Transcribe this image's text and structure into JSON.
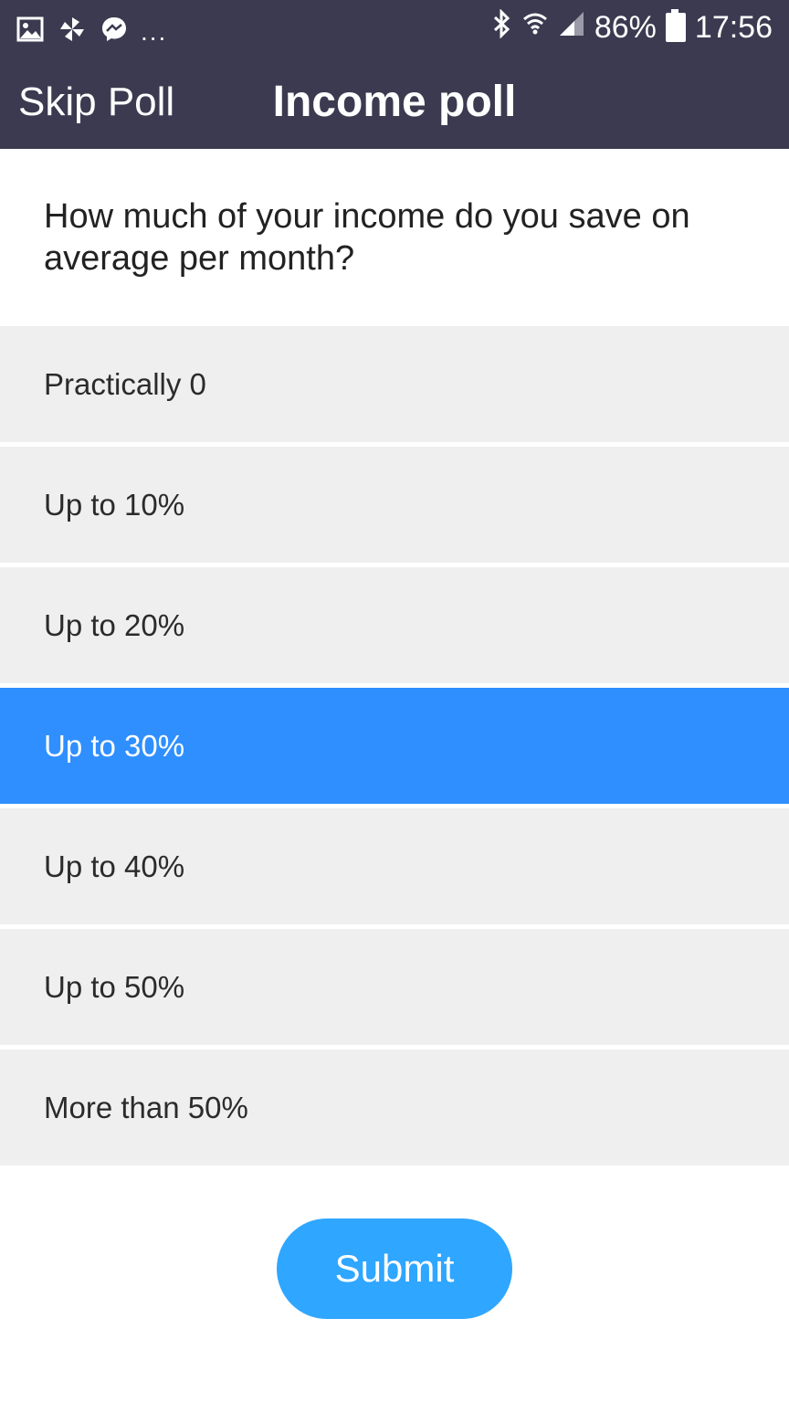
{
  "status_bar": {
    "left_icons": [
      "gallery-icon",
      "pinwheel-icon",
      "messenger-icon"
    ],
    "more": "...",
    "right_icons": [
      "bluetooth-icon",
      "wifi-icon",
      "signal-icon",
      "battery-icon"
    ],
    "battery": "86%",
    "time": "17:56"
  },
  "header": {
    "skip_label": "Skip Poll",
    "title": "Income poll",
    "background": "#3b3a50"
  },
  "poll": {
    "question": "How much of your income do you save on average per month?",
    "options": [
      {
        "label": "Practically 0",
        "selected": false
      },
      {
        "label": "Up to 10%",
        "selected": false
      },
      {
        "label": "Up to 20%",
        "selected": false
      },
      {
        "label": "Up to 30%",
        "selected": true
      },
      {
        "label": "Up to 40%",
        "selected": false
      },
      {
        "label": "Up to 50%",
        "selected": false
      },
      {
        "label": "More than 50%",
        "selected": false
      }
    ],
    "selected_color": "#2f8fff"
  },
  "submit": {
    "label": "Submit",
    "color": "#2fa6ff"
  }
}
